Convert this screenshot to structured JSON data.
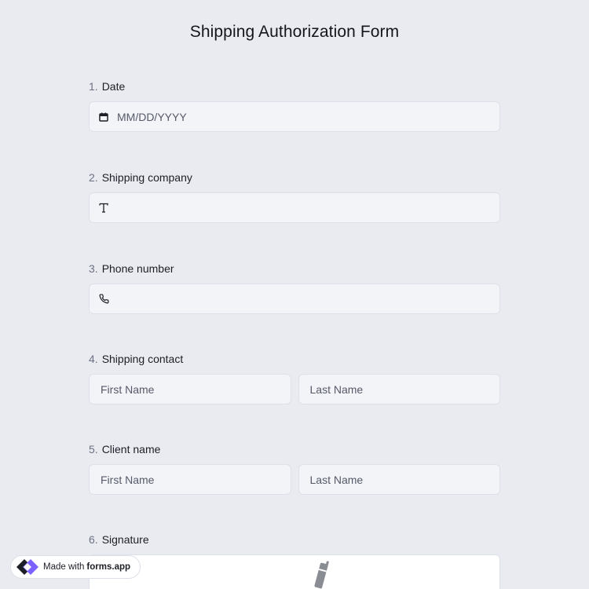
{
  "form": {
    "title": "Shipping Authorization Form"
  },
  "questions": [
    {
      "num": "1.",
      "label": "Date",
      "icon": "calendar-icon",
      "placeholder": "MM/DD/YYYY"
    },
    {
      "num": "2.",
      "label": "Shipping company",
      "icon": "text-T-icon",
      "placeholder": ""
    },
    {
      "num": "3.",
      "label": "Phone number",
      "icon": "phone-icon",
      "placeholder": ""
    },
    {
      "num": "4.",
      "label": "Shipping contact",
      "first_placeholder": "First Name",
      "last_placeholder": "Last Name"
    },
    {
      "num": "5.",
      "label": "Client name",
      "first_placeholder": "First Name",
      "last_placeholder": "Last Name"
    },
    {
      "num": "6.",
      "label": "Signature",
      "icon": "pen-icon"
    }
  ],
  "badge": {
    "prefix": "Made with",
    "brand": "forms.app",
    "icon": "forms-app-logo"
  },
  "colors": {
    "background": "#e9ebf1",
    "field_bg": "#f3f4f8",
    "logo_purple": "#7b61ff"
  }
}
